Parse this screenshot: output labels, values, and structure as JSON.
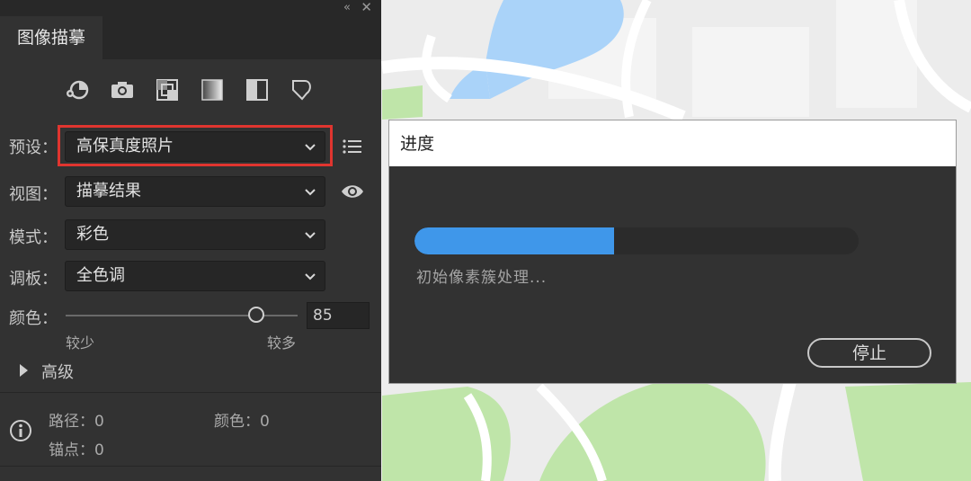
{
  "panel": {
    "title_tab": "图像描摹",
    "collapse_glyph": "«",
    "close_glyph": "✕",
    "preset_icons": [
      "auto-color-icon",
      "photo-camera-icon",
      "grayscale-grid-icon",
      "gradient-square-icon",
      "half-tone-icon",
      "outline-tag-icon"
    ],
    "preset": {
      "label": "预设：",
      "value": "高保真度照片"
    },
    "view": {
      "label": "视图：",
      "value": "描摹结果"
    },
    "mode": {
      "label": "模式：",
      "value": "彩色"
    },
    "palette": {
      "label": "调板：",
      "value": "全色调"
    },
    "colors": {
      "label": "颜色：",
      "value": "85",
      "min_label": "较少",
      "max_label": "较多",
      "slider_fraction": 0.82
    },
    "advanced": {
      "label": "高级"
    },
    "stats": {
      "paths": "路径：0",
      "colors": "颜色：0",
      "anchors": "锚点：0"
    }
  },
  "dialog": {
    "title": "进度",
    "status": "初始像素簇处理...",
    "progress_fraction": 0.45,
    "stop_label": "停止"
  },
  "colors": {
    "panel_bg": "#323232",
    "accent_red": "#e0352f",
    "progress_blue": "#3f97ea",
    "map_water": "#aad3f9",
    "map_green": "#bfe5a9"
  }
}
